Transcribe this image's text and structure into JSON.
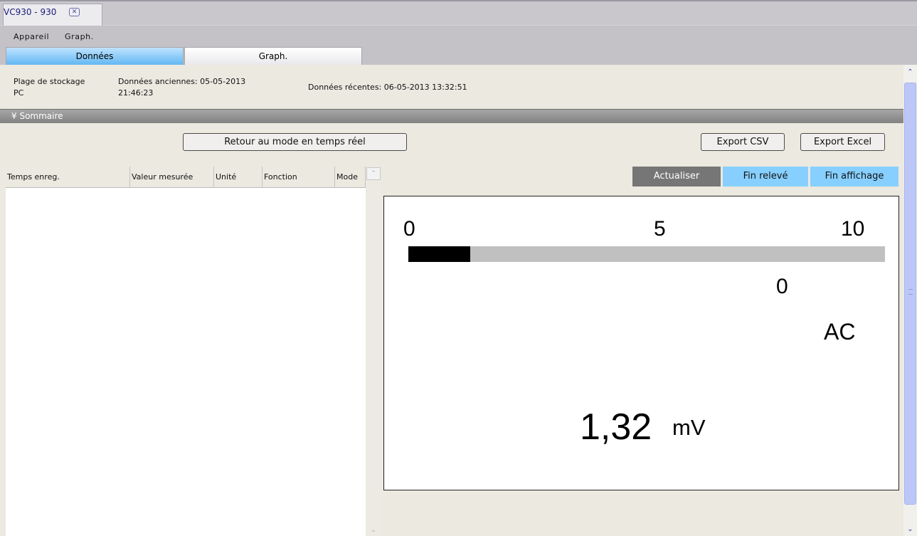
{
  "document_tab": {
    "title": "VC930 - 930",
    "close_glyph": "✕"
  },
  "menu": {
    "items": [
      "Appareil",
      "Graph."
    ]
  },
  "tabs": [
    {
      "label": "Données",
      "active": true
    },
    {
      "label": "Graph.",
      "active": false
    }
  ],
  "info": {
    "storage_label": "Plage de stockage",
    "storage_value": "PC",
    "old_data_line1": "Données anciennes: 05-05-2013",
    "old_data_line2": "21:46:23",
    "recent_data": "Données récentes: 06-05-2013 13:32:51"
  },
  "summary": {
    "label": "Sommaire",
    "chevron": "¥"
  },
  "buttons": {
    "retour": "Retour au mode en temps réel",
    "export_csv": "Export CSV",
    "export_excel": "Export Excel",
    "actualiser": "Actualiser",
    "fin_releve": "Fin relevé",
    "fin_affichage": "Fin affichage"
  },
  "table": {
    "columns": [
      "Temps enreg.",
      "Valeur mesurée",
      "Unité",
      "Fonction",
      "Mode"
    ],
    "rows": []
  },
  "meter": {
    "scale": [
      "0",
      "5",
      "10"
    ],
    "bar_fraction": 0.13,
    "range_value": "0",
    "mode": "AC",
    "reading": "1,32",
    "unit": "mV"
  },
  "scroll": {
    "up_glyph": "⌃",
    "down_glyph": "⌄"
  },
  "colors": {
    "active_tab": "#62b8f3",
    "action_blue": "#87cfff",
    "actualiser_gray": "#767676"
  }
}
